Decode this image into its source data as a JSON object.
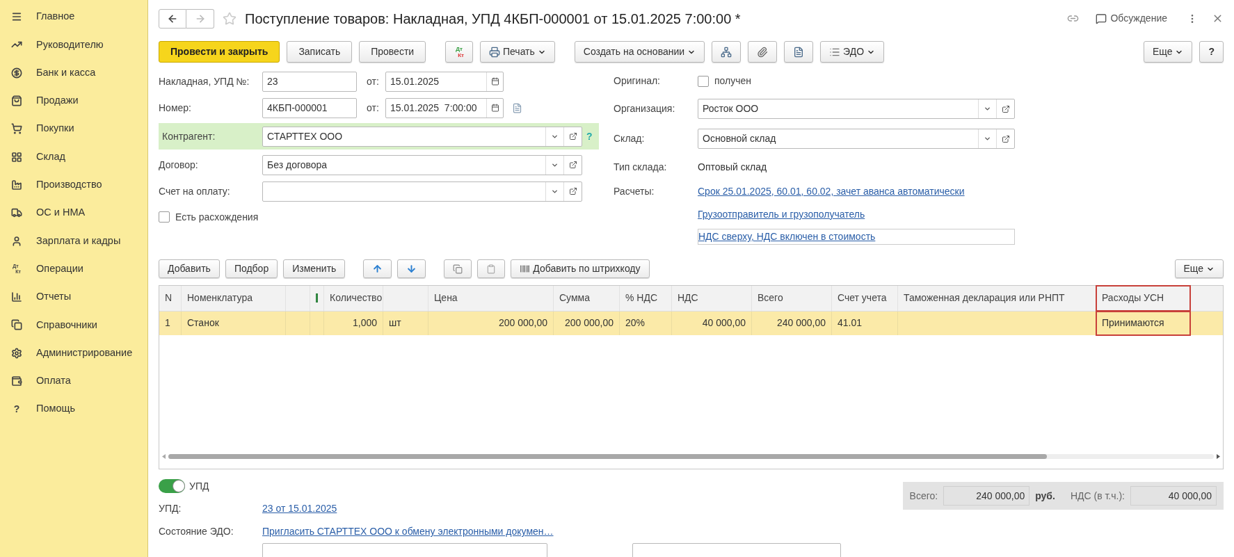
{
  "sidebar": {
    "items": [
      {
        "label": "Главное"
      },
      {
        "label": "Руководителю"
      },
      {
        "label": "Банк и касса"
      },
      {
        "label": "Продажи"
      },
      {
        "label": "Покупки"
      },
      {
        "label": "Склад"
      },
      {
        "label": "Производство"
      },
      {
        "label": "ОС и НМА"
      },
      {
        "label": "Зарплата и кадры"
      },
      {
        "label": "Операции",
        "icon_text": [
          "Дт",
          "Кт"
        ]
      },
      {
        "label": "Отчеты"
      },
      {
        "label": "Справочники"
      },
      {
        "label": "Администрирование"
      },
      {
        "label": "Оплата"
      },
      {
        "label": "Помощь",
        "icon_text": [
          "?"
        ]
      }
    ]
  },
  "header": {
    "title": "Поступление товаров: Накладная, УПД 4КБП-000001 от 15.01.2025 7:00:00 *",
    "favorite": false,
    "discussion": "Обсуждение"
  },
  "toolbar": {
    "buttons": [
      {
        "kind": "primary",
        "label": "Провести и закрыть"
      },
      {
        "kind": "plain",
        "label": "Записать"
      },
      {
        "kind": "plain",
        "label": "Провести"
      },
      {
        "kind": "dtkt",
        "icon_text": [
          "Дт",
          "Кт"
        ]
      },
      {
        "kind": "print",
        "label": "Печать"
      },
      {
        "kind": "dropdown",
        "label": "Создать на основании"
      },
      {
        "kind": "structure"
      },
      {
        "kind": "clip"
      },
      {
        "kind": "list"
      },
      {
        "kind": "edo",
        "label": "ЭДО"
      }
    ],
    "more": "Еще",
    "help": "?"
  },
  "form_left": {
    "fields": [
      {
        "kind": "text",
        "label": "Накладная, УПД №:",
        "value": "23",
        "date_label": "от:",
        "date": "15.01.2025"
      },
      {
        "kind": "text",
        "label": "Номер:",
        "value": "4КБП-000001",
        "date_label": "от:",
        "date": "15.01.2025  7:00:00",
        "extra": true
      },
      {
        "kind": "select",
        "label": "Контрагент:",
        "value": "СТАРТТЕХ ООО",
        "highlighted": true,
        "help": "?"
      },
      {
        "kind": "select",
        "label": "Договор:",
        "value": "Без договора",
        "highlighted": false
      },
      {
        "kind": "select",
        "label": "Счет на оплату:",
        "highlighted": false
      }
    ],
    "checkbox": {
      "label": "Есть расхождения",
      "checked": false
    }
  },
  "form_right": {
    "fields": [
      {
        "kind": "checkbox",
        "label": "Оригинал:",
        "option": "получен",
        "checked": false
      },
      {
        "kind": "select",
        "label": "Организация:",
        "value": "Росток ООО"
      },
      {
        "kind": "select",
        "label": "Склад:",
        "value": "Основной склад"
      },
      {
        "kind": "text",
        "label": "Тип склада:",
        "value": "Оптовый склад"
      },
      {
        "kind": "link",
        "label": "Расчеты:",
        "value": "Срок 25.01.2025, 60.01, 60.02, зачет аванса автоматически"
      },
      {
        "kind": "link",
        "value": "Грузоотправитель и грузополучатель"
      },
      {
        "kind": "boxed-link",
        "value": "НДС сверху, НДС включен в стоимость"
      }
    ]
  },
  "table_toolbar": {
    "buttons": [
      {
        "kind": "plain",
        "label": "Добавить"
      },
      {
        "kind": "plain",
        "label": "Подбор"
      },
      {
        "kind": "plain",
        "label": "Изменить"
      },
      {
        "kind": "up"
      },
      {
        "kind": "down"
      },
      {
        "kind": "copy"
      },
      {
        "kind": "paste"
      },
      {
        "kind": "barcode",
        "label": "Добавить по штрихкоду"
      }
    ],
    "more": "Еще"
  },
  "table": {
    "columns": [
      {
        "label": "N",
        "highlighted": false
      },
      {
        "label": "Номенклатура",
        "highlighted": false
      },
      {
        "highlighted": false
      },
      {
        "kind": "icon",
        "highlighted": false
      },
      {
        "label": "Количество",
        "highlighted": false
      },
      {
        "highlighted": false
      },
      {
        "label": "Цена",
        "highlighted": false
      },
      {
        "label": "Сумма",
        "highlighted": false
      },
      {
        "label": "% НДС",
        "highlighted": false
      },
      {
        "label": "НДС",
        "highlighted": false
      },
      {
        "label": "Всего",
        "highlighted": false
      },
      {
        "label": "Счет учета",
        "highlighted": false
      },
      {
        "label": "Таможенная декларация или РНПТ",
        "highlighted": false
      },
      {
        "label": "Расходы УСН",
        "highlighted": true
      }
    ],
    "rows": [
      {
        "selected": true,
        "cells": [
          "1",
          "Станок",
          "",
          "",
          "1,000",
          "шт",
          "200 000,00",
          "200 000,00",
          "20%",
          "40 000,00",
          "240 000,00",
          "41.01",
          "",
          "Принимаются"
        ]
      }
    ]
  },
  "footer": {
    "toggle": {
      "label": "УПД",
      "on": true
    },
    "totals": {
      "total_label": "Всего:",
      "total": "240 000,00",
      "currency": "руб.",
      "vat_label": "НДС (в т.ч.):",
      "vat": "40 000,00"
    },
    "rows": [
      {
        "label": "УПД:",
        "link": "23 от 15.01.2025"
      },
      {
        "label": "Состояние ЭДО:",
        "link": "Пригласить СТАРТТЕХ ООО к обмену электронными докумен…"
      }
    ]
  }
}
